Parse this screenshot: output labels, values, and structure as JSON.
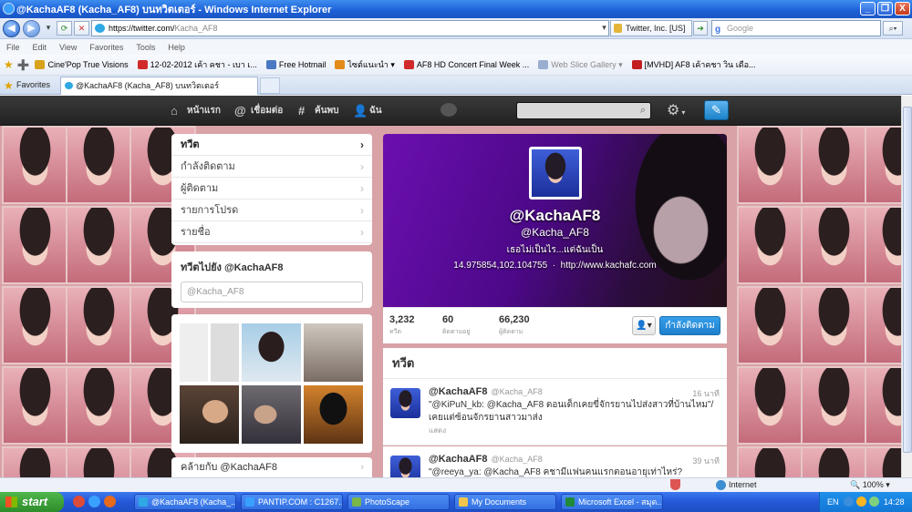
{
  "window": {
    "title": "@KachaAF8 (Kacha_AF8) บนทวิตเตอร์ - Windows Internet Explorer",
    "minimize": "_",
    "restore": "❐",
    "close": "X"
  },
  "address": {
    "host": "https://twitter.com/",
    "path": "Kacha_AF8",
    "security": "Twitter, Inc. [US]",
    "search_placeholder": "Google",
    "search_g": "g"
  },
  "menu": [
    "File",
    "Edit",
    "View",
    "Favorites",
    "Tools",
    "Help"
  ],
  "favorites_bar": [
    {
      "label": "Cine'Pop True Visions",
      "color": "#d9a21b",
      "dim": false
    },
    {
      "label": "12-02-2012 เค้า คชา - เบา เ...",
      "color": "#d12a2a",
      "dim": false
    },
    {
      "label": "Free Hotmail",
      "color": "#4a78c2",
      "dim": false
    },
    {
      "label": "ไซต์แนะนำ ▾",
      "color": "#e28b1a",
      "dim": false
    },
    {
      "label": "AF8 HD Concert Final Week ...",
      "color": "#d12a2a",
      "dim": false
    },
    {
      "label": "Web Slice Gallery ▾",
      "color": "#9aaed0",
      "dim": true
    },
    {
      "label": "[MVHD] AF8 เค้าคชา วิน เดือ...",
      "color": "#c41f1f",
      "dim": false
    }
  ],
  "tabs": {
    "favorites_label": "Favorites",
    "active_tab": "@KachaAF8 (Kacha_AF8) บนทวิตเตอร์"
  },
  "twitter_nav": [
    {
      "icon": "home-icon",
      "glyph": "⌂",
      "label": "หน้าแรก"
    },
    {
      "icon": "at-icon",
      "glyph": "@",
      "label": "เชื่อมต่อ"
    },
    {
      "icon": "hashtag-icon",
      "glyph": "#",
      "label": "ค้นพบ"
    },
    {
      "icon": "user-icon",
      "glyph": "👤",
      "label": "ฉัน"
    }
  ],
  "left_menu": [
    {
      "label": "ทวีต",
      "active": true
    },
    {
      "label": "กำลังติดตาม",
      "active": false
    },
    {
      "label": "ผู้ติดตาม",
      "active": false
    },
    {
      "label": "รายการโปรด",
      "active": false
    },
    {
      "label": "รายชื่อ",
      "active": false
    }
  ],
  "tweet_to": {
    "heading": "ทวีตไปยัง @KachaAF8",
    "placeholder": "@Kacha_AF8"
  },
  "similar": {
    "label": "คล้ายกับ @KachaAF8"
  },
  "profile": {
    "name": "@KachaAF8",
    "handle": "@Kacha_AF8",
    "bio": "เธอไม่เป็นไร...แต่ฉันเป็น",
    "location": "14.975854,102.104755",
    "url": "http://www.kachafc.com",
    "separator": "·",
    "stats": [
      {
        "value": "3,232",
        "label": "ทวีต"
      },
      {
        "value": "60",
        "label": "ติดตามอยู่"
      },
      {
        "value": "66,230",
        "label": "ผู้ติดตาม"
      }
    ],
    "user_menu_button": "👤▾",
    "following_button": "กำลังติดตาม"
  },
  "tweets": {
    "heading": "ทวีต",
    "items": [
      {
        "name": "@KachaAF8",
        "screen_name": "@Kacha_AF8",
        "time": "16 นาที",
        "text": "\"@KiPuN_kb: @Kacha_AF8 ตอนเด็กเคยขี่จักรยานไปส่งสาวที่บ้านไหม\"/เคยแต่ซ้อนจักรยานสาวมาส่ง",
        "expand": "แสดง"
      },
      {
        "name": "@KachaAF8",
        "screen_name": "@Kacha_AF8",
        "time": "39 นาที",
        "text": "\"@reeya_ya: @Kacha_AF8 คชามีแฟนคนแรกตอนอายุเท่าไหร่?",
        "expand": ""
      }
    ]
  },
  "statusbar": {
    "zone": "Internet",
    "zoom": "🔍 100% ▾"
  },
  "taskbar": {
    "start": "start",
    "items": [
      {
        "label": "@KachaAF8 (Kacha_...",
        "color": "#2fa8e6"
      },
      {
        "label": "PANTIP.COM : C1267...",
        "color": "#3aa0ff"
      },
      {
        "label": "PhotoScape",
        "color": "#7ab648"
      },
      {
        "label": "My Documents",
        "color": "#f0c64c"
      },
      {
        "label": "Microsoft Excel - สมุด...",
        "color": "#1f8a3a"
      }
    ],
    "lang": "EN",
    "clock": "14:28"
  }
}
